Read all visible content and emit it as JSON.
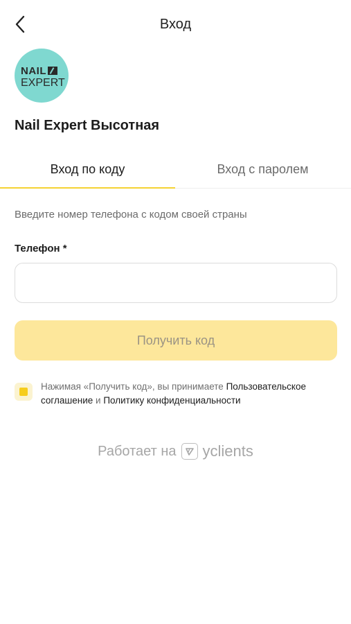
{
  "header": {
    "title": "Вход",
    "back_icon": "chevron-left-icon"
  },
  "salon": {
    "logo_line1": "NAIL",
    "logo_line2": "EXPERT",
    "name": "Nail Expert Высотная"
  },
  "tabs": [
    {
      "label": "Вход по коду",
      "active": true
    },
    {
      "label": "Вход с паролем",
      "active": false
    }
  ],
  "form": {
    "hint": "Введите номер телефона с кодом своей страны",
    "phone_label": "Телефон *",
    "phone_value": "",
    "submit_label": "Получить код"
  },
  "consent": {
    "checked": true,
    "prefix": "Нажимая «Получить код», вы принимаете",
    "agreement_link": "Пользовательское соглашение",
    "conjunction": "и",
    "privacy_link": "Политику конфиденциальности"
  },
  "footer": {
    "powered_by": "Работает на",
    "brand": "yclients"
  },
  "colors": {
    "accent": "#f5d232",
    "button_disabled": "#fde79b",
    "logo_bg": "#7fd8d0"
  }
}
